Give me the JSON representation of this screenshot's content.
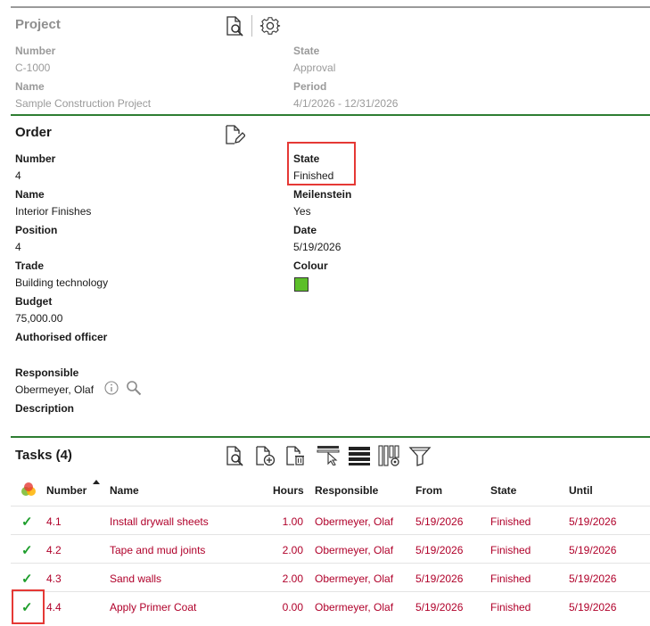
{
  "project": {
    "title": "Project",
    "number_label": "Number",
    "number_value": "C-1000",
    "name_label": "Name",
    "name_value": "Sample Construction Project",
    "state_label": "State",
    "state_value": "Approval",
    "period_label": "Period",
    "period_value": "4/1/2026 - 12/31/2026"
  },
  "order": {
    "title": "Order",
    "number_label": "Number",
    "number_value": "4",
    "name_label": "Name",
    "name_value": "Interior Finishes",
    "position_label": "Position",
    "position_value": "4",
    "trade_label": "Trade",
    "trade_value": "Building technology",
    "budget_label": "Budget",
    "budget_value": "75,000.00",
    "officer_label": "Authorised officer",
    "officer_value": "",
    "responsible_label": "Responsible",
    "responsible_value": "Obermeyer, Olaf",
    "description_label": "Description",
    "state_label": "State",
    "state_value": "Finished",
    "milestone_label": "Meilenstein",
    "milestone_value": "Yes",
    "date_label": "Date",
    "date_value": "5/19/2026",
    "colour_label": "Colour",
    "colour_hex": "#5cbf2a"
  },
  "tasks": {
    "title": "Tasks (4)",
    "columns": [
      "Number",
      "Name",
      "Hours",
      "Responsible",
      "From",
      "State",
      "Until"
    ],
    "rows": [
      {
        "number": "4.1",
        "name": "Install drywall sheets",
        "hours": "1.00",
        "responsible": "Obermeyer, Olaf",
        "from": "5/19/2026",
        "state": "Finished",
        "until": "5/19/2026"
      },
      {
        "number": "4.2",
        "name": "Tape and mud joints",
        "hours": "2.00",
        "responsible": "Obermeyer, Olaf",
        "from": "5/19/2026",
        "state": "Finished",
        "until": "5/19/2026"
      },
      {
        "number": "4.3",
        "name": "Sand walls",
        "hours": "2.00",
        "responsible": "Obermeyer, Olaf",
        "from": "5/19/2026",
        "state": "Finished",
        "until": "5/19/2026"
      },
      {
        "number": "4.4",
        "name": "Apply Primer Coat",
        "hours": "0.00",
        "responsible": "Obermeyer, Olaf",
        "from": "5/19/2026",
        "state": "Finished",
        "until": "5/19/2026"
      }
    ]
  },
  "icons": {
    "project_view": "document-search-icon",
    "project_settings": "gear-icon",
    "order_edit": "document-edit-icon",
    "info": "info-icon",
    "search": "search-icon",
    "task_view": "document-search-icon",
    "task_add": "document-add-icon",
    "task_delete": "document-delete-icon",
    "task_select": "select-cursor-icon",
    "task_rows": "rows-icon",
    "task_columns": "column-settings-icon",
    "task_filter": "filter-icon",
    "status": "status-dots-icon",
    "check": "check-icon"
  },
  "colors": {
    "accent_green": "#2e7d32",
    "row_text": "#b0002a",
    "check_green": "#1e9e2c",
    "highlight_red": "#e53935"
  }
}
